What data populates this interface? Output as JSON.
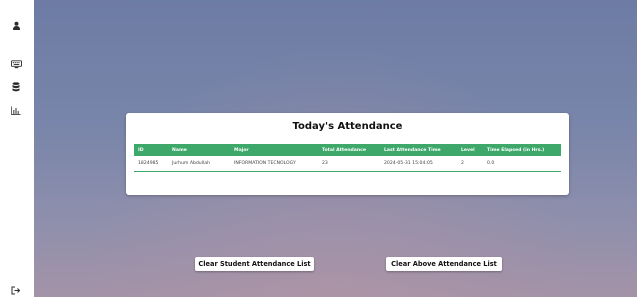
{
  "sidebar": {
    "icons": [
      "user-icon",
      "keyboard-icon",
      "database-icon",
      "chart-icon",
      "logout-icon"
    ]
  },
  "attendance": {
    "title": "Today's Attendance",
    "columns": [
      "ID",
      "Name",
      "Major",
      "Total Attendance",
      "Last Attendance Time",
      "Level",
      "Time Elapsed (in Hrs.)"
    ],
    "rows": [
      [
        "1824985",
        "Jurhum Abdullah",
        "INFORMATION TECNOLOGY",
        "23",
        "2024-05-31 15:04:05",
        "2",
        "0.0"
      ]
    ],
    "header_color": "#3ea86a"
  },
  "actions": {
    "clear_student": "Clear Student Attendance List",
    "clear_above": "Clear Above Attendance List"
  }
}
